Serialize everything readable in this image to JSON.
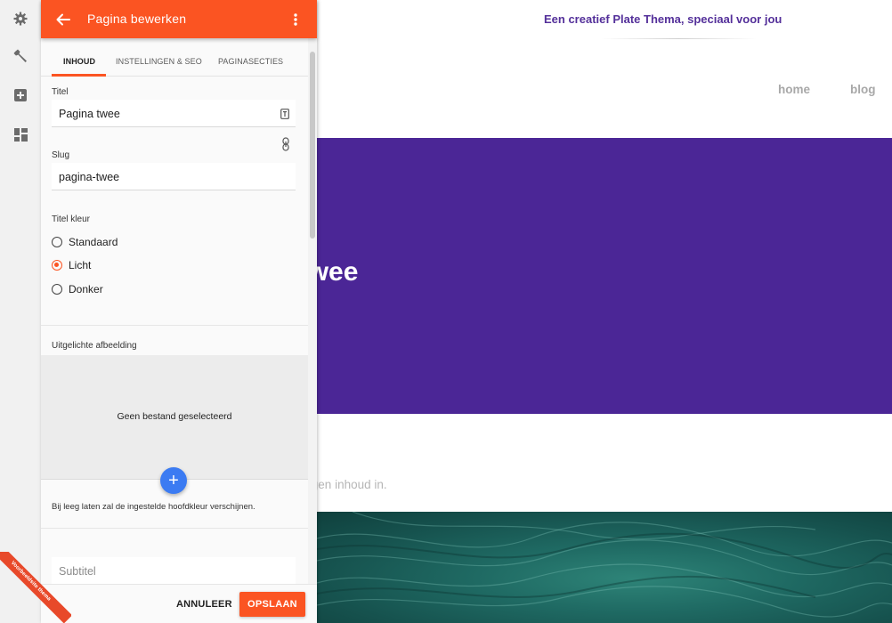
{
  "editor": {
    "title": "Pagina bewerken",
    "tabs": [
      {
        "label": "INHOUD"
      },
      {
        "label": "INSTELLINGEN & SEO"
      },
      {
        "label": "PAGINASECTIES"
      }
    ],
    "title_field": {
      "label": "Titel",
      "value": "Pagina twee"
    },
    "slug_field": {
      "label": "Slug",
      "value": "pagina-twee"
    },
    "title_color": {
      "label": "Titel kleur",
      "options": [
        "Standaard",
        "Licht",
        "Donker"
      ],
      "selected": "Licht"
    },
    "featured_image": {
      "label": "Uitgelichte afbeelding",
      "empty_text": "Geen bestand geselecteerd",
      "hint": "Bij leeg laten zal de ingestelde hoofdkleur verschijnen."
    },
    "subtitle_field": {
      "placeholder": "Subtitel"
    },
    "cancel_label": "ANNULEER",
    "save_label": "OPSLAAN",
    "accent_color": "#fb5422"
  },
  "ribbon": {
    "text": "Voorbeeldsite thema"
  },
  "site": {
    "tagline": "Een creatief Plate Thema, speciaal voor jou",
    "nav": [
      "home",
      "blog"
    ],
    "hero_title": "Pagina twee",
    "body_text": "Vul hier je eigen inhoud in.",
    "hero_color": "#4b2696",
    "tagline_color": "#54309a"
  },
  "rail_icons": [
    "gear-icon",
    "wrench-icon",
    "add-box-icon",
    "dashboard-icon"
  ]
}
